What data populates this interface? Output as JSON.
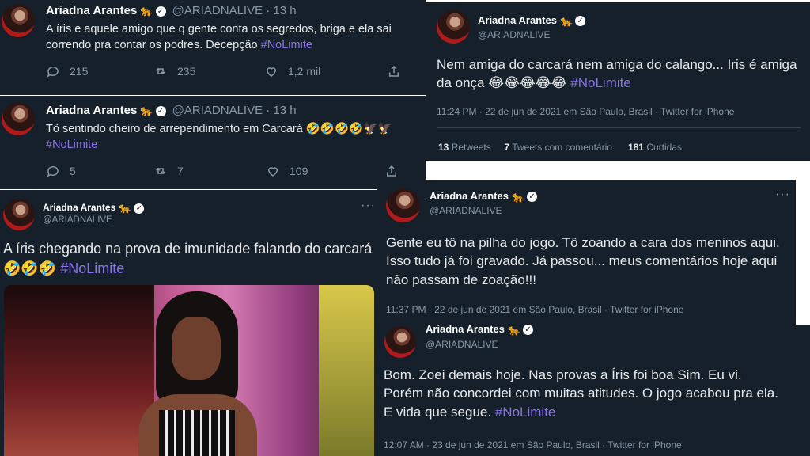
{
  "tweet1": {
    "name": "Ariadna Arantes",
    "handle": "@ARIADNALIVE · 13 h",
    "text": "A íris e aquele amigo que q gente conta os segredos, briga e ela sai correndo pra contar os podres.  Decepção",
    "hashtag": "#NoLimite",
    "replies": "215",
    "retweets": "235",
    "likes": "1,2 mil"
  },
  "tweet2": {
    "name": "Ariadna Arantes",
    "handle": "@ARIADNALIVE · 13 h",
    "text": "Tô sentindo cheiro de arrependimento em Carcará 🤣🤣🤣🤣🦅🦅",
    "hashtag": "#NoLimite",
    "replies": "5",
    "retweets": "7",
    "likes": "109"
  },
  "tweet3": {
    "name": "Ariadna Arantes",
    "handle": "@ARIADNALIVE",
    "text": "Nem amiga do carcará nem amiga do calango... Iris é amiga da onça 😂😂😂😂😂",
    "hashtag": "#NoLimite",
    "meta": "11:24 PM · 22 de jun de 2021 em São Paulo, Brasil · Twitter for iPhone",
    "retweets_count": "13",
    "retweets_label": "Retweets",
    "comments_count": "7",
    "comments_label": "Tweets com comentário",
    "likes_count": "181",
    "likes_label": "Curtidas"
  },
  "tweet4": {
    "name": "Ariadna Arantes",
    "handle": "@ARIADNALIVE",
    "text": "A íris chegando na prova de imunidade falando do carcará 🤣🤣🤣",
    "hashtag": "#NoLimite"
  },
  "tweet5": {
    "name": "Ariadna Arantes",
    "handle": "@ARIADNALIVE",
    "text": "Gente eu tô na pilha do jogo. Tô zoando a cara dos meninos aqui. Isso tudo já foi gravado. Já passou... meus comentários hoje aqui não passam de zoação!!!",
    "meta": "11:37 PM · 22 de jun de 2021 em São Paulo, Brasil · Twitter for iPhone"
  },
  "tweet6": {
    "name": "Ariadna Arantes",
    "handle": "@ARIADNALIVE",
    "text": "Bom. Zoei demais hoje. Nas provas a Íris foi boa Sim. Eu vi. Porém não concordei com muitas atitudes. O jogo acabou pra ela. E vida que segue.",
    "hashtag": "#NoLimite",
    "meta": "12:07 AM · 23 de jun de 2021 em São Paulo, Brasil · Twitter for iPhone"
  },
  "icons": {
    "badge": "✓",
    "cat": "🐆",
    "more": "···"
  },
  "colors": {
    "background": "#15202b",
    "hashtag": "#8a73e6",
    "muted": "#8899a6"
  }
}
